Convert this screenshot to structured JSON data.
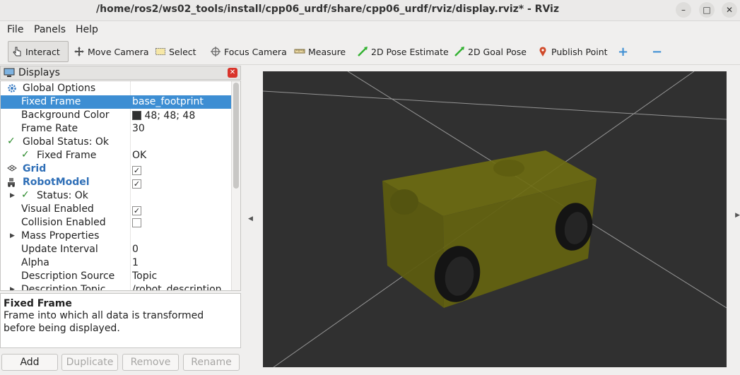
{
  "window": {
    "title": "/home/ros2/ws02_tools/install/cpp06_urdf/share/cpp06_urdf/rviz/display.rviz* - RViz",
    "minimize": "–",
    "maximize": "□",
    "close": "✕"
  },
  "menu": [
    "File",
    "Panels",
    "Help"
  ],
  "toolbar": {
    "interact": "Interact",
    "move_camera": "Move Camera",
    "select": "Select",
    "focus_camera": "Focus Camera",
    "measure": "Measure",
    "pose_estimate": "2D Pose Estimate",
    "goal_pose": "2D Goal Pose",
    "publish_point": "Publish Point",
    "add_tool": "+",
    "remove_tool": "−",
    "accent": "#3d8ed3"
  },
  "displays_panel": {
    "title": "Displays",
    "rows": [
      {
        "name": "Global Options",
        "value": ""
      },
      {
        "name": "Fixed Frame",
        "value": "base_footprint"
      },
      {
        "name": "Background Color",
        "value": "48; 48; 48"
      },
      {
        "name": "Frame Rate",
        "value": "30"
      },
      {
        "name": "Global Status: Ok",
        "value": ""
      },
      {
        "name": "Fixed Frame",
        "value": "OK"
      },
      {
        "name": "Grid",
        "value": "✓"
      },
      {
        "name": "RobotModel",
        "value": "✓"
      },
      {
        "name": "Status: Ok",
        "value": ""
      },
      {
        "name": "Visual Enabled",
        "value": "✓"
      },
      {
        "name": "Collision Enabled",
        "value": ""
      },
      {
        "name": "Mass Properties",
        "value": ""
      },
      {
        "name": "Update Interval",
        "value": "0"
      },
      {
        "name": "Alpha",
        "value": "1"
      },
      {
        "name": "Description Source",
        "value": "Topic"
      },
      {
        "name": "Description Topic",
        "value": "/robot_description"
      }
    ],
    "background_swatch": "#303030"
  },
  "description": {
    "title": "Fixed Frame",
    "text": "Frame into which all data is transformed before being displayed."
  },
  "buttons": {
    "add": "Add",
    "duplicate": "Duplicate",
    "remove": "Remove",
    "rename": "Rename"
  },
  "viewport": {
    "background": "#303030",
    "robot_color": "#6b6a18",
    "wheel_color": "#111111"
  }
}
